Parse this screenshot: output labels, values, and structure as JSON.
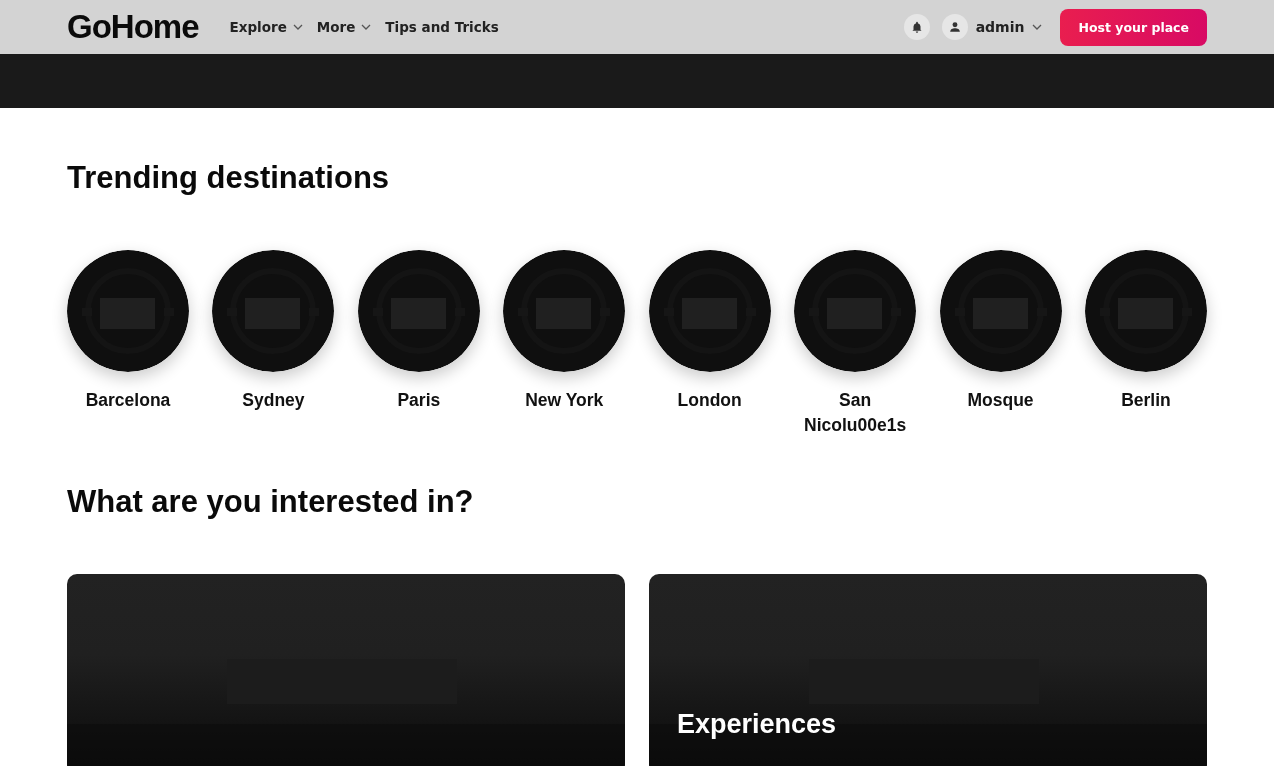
{
  "header": {
    "logo": "GoHome",
    "nav": [
      {
        "label": "Explore",
        "dropdown": true
      },
      {
        "label": "More",
        "dropdown": true
      },
      {
        "label": "Tips and Tricks",
        "dropdown": false
      }
    ],
    "user": "admin",
    "cta": "Host your place"
  },
  "trending": {
    "title": "Trending destinations",
    "items": [
      {
        "name": "Barcelona"
      },
      {
        "name": "Sydney"
      },
      {
        "name": "Paris"
      },
      {
        "name": "New York"
      },
      {
        "name": "London"
      },
      {
        "name": "San Nicolu00e1s"
      },
      {
        "name": "Mosque"
      },
      {
        "name": "Berlin"
      }
    ]
  },
  "interests": {
    "title": "What are you interested in?",
    "cards": [
      {
        "kind": "picture"
      },
      {
        "kind": "picture",
        "title": "Experiences"
      }
    ]
  }
}
